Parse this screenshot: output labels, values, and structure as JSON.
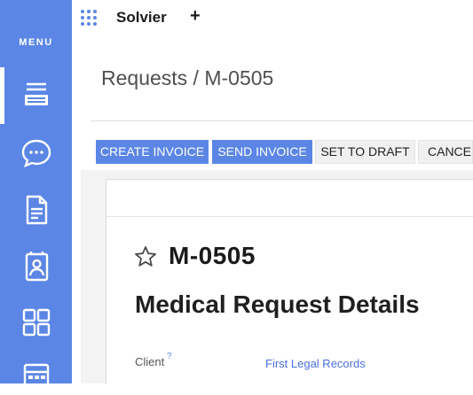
{
  "app": {
    "name": "Solvier",
    "new_label": "+"
  },
  "sidebar": {
    "menu_label": "MENU",
    "items": [
      {
        "icon": "list-stack-icon",
        "active": true
      },
      {
        "icon": "chat-bubble-icon",
        "active": false
      },
      {
        "icon": "document-icon",
        "active": false
      },
      {
        "icon": "contact-card-icon",
        "active": false
      },
      {
        "icon": "dashboard-grid-icon",
        "active": false
      },
      {
        "icon": "calculator-icon",
        "active": false
      }
    ]
  },
  "breadcrumb": "Requests / M-0505",
  "toolbar": {
    "create_invoice": "CREATE INVOICE",
    "send_invoice": "SEND INVOICE",
    "set_to_draft": "SET TO DRAFT",
    "cancel": "CANCEL"
  },
  "record": {
    "reference": "M-0505",
    "title": "Medical Request Details",
    "fields": {
      "client_label": "Client",
      "client_help": "?",
      "client_value": "First Legal Records"
    }
  },
  "colors": {
    "primary": "#5b86e5",
    "link": "#4a6fd9"
  }
}
